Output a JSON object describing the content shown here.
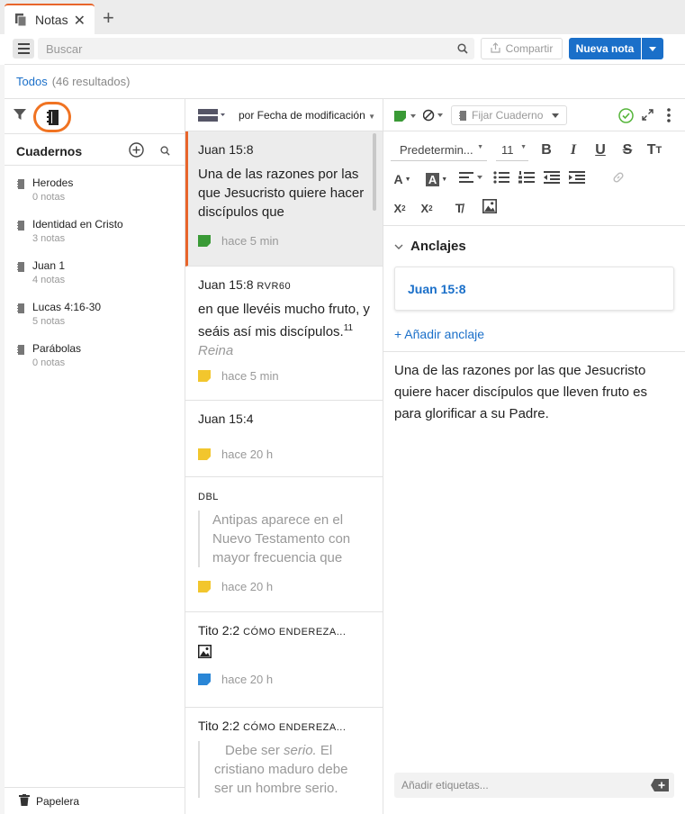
{
  "tab": {
    "title": "Notas",
    "close": "✕",
    "new": "+"
  },
  "toolbar": {
    "search_placeholder": "Buscar",
    "share_label": "Compartir",
    "new_note_label": "Nueva nota"
  },
  "filter": {
    "scope": "Todos",
    "count": "(46 resultados)"
  },
  "notebooks": {
    "title": "Cuadernos",
    "items": [
      {
        "name": "Herodes",
        "count": "0 notas"
      },
      {
        "name": "Identidad en Cristo",
        "count": "3 notas"
      },
      {
        "name": "Juan 1",
        "count": "4 notas"
      },
      {
        "name": "Lucas 4:16-30",
        "count": "5 notas"
      },
      {
        "name": "Parábolas",
        "count": "0 notas"
      }
    ],
    "trash": "Papelera"
  },
  "notes_list": {
    "sort_label": "por Fecha de modificación",
    "items": [
      {
        "title": "Juan 15:8",
        "title_small": "",
        "body": "Una de las razones por las que Jesucristo quiere hacer discípulos que",
        "quote": "",
        "time": "hace 5 min",
        "tag_color": "#3a9a36"
      },
      {
        "title": "Juan 15:8",
        "title_small": "RVR60",
        "body": "en que llevéis mucho fruto, y seáis así mis discípulos.",
        "sup": "11",
        "italic": "Reina",
        "quote": "",
        "time": "hace 5 min",
        "tag_color": "#f2c62d"
      },
      {
        "title": "Juan 15:4",
        "title_small": "",
        "body": "",
        "quote": "",
        "time": "hace 20 h",
        "tag_color": "#f2c62d"
      },
      {
        "title": "",
        "title_small": "DBL",
        "body": "",
        "quote": "Antipas aparece en el Nuevo Testamento con mayor frecuencia que",
        "time": "hace 20 h",
        "tag_color": "#f2c62d"
      },
      {
        "title": "Tito 2:2",
        "title_small": "CÓMO ENDEREZA...",
        "body": "",
        "quote": "",
        "time": "hace 20 h",
        "tag_color": "#2a86d6"
      },
      {
        "title": "Tito 2:2",
        "title_small": "CÓMO ENDEREZA...",
        "body": "",
        "quote_a": "Debe ser ",
        "quote_i": "serio.",
        "quote_b": " El cristiano maduro debe ser un hombre serio.",
        "time": "",
        "tag_color": ""
      }
    ]
  },
  "editor": {
    "pin_notebook": "Fijar Cuaderno",
    "font": "Predetermin...",
    "size": "11",
    "anchors_title": "Anclajes",
    "anchor": "Juan 15:8",
    "add_anchor": "+ Añadir anclaje",
    "content": "Una de las razones por las que Jesucristo quiere hacer discípulos que lleven fruto es para glorificar a su Padre.",
    "tags_placeholder": "Añadir etiquetas..."
  },
  "colors": {
    "accent": "#1a6fc9",
    "highlight": "#f07322",
    "selected_border": "#e8652b"
  }
}
